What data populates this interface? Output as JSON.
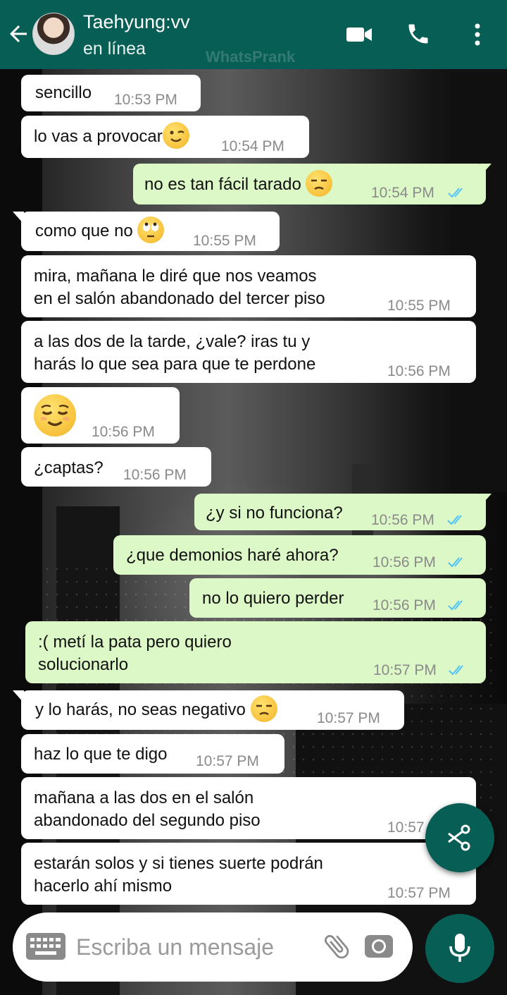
{
  "header": {
    "contact_name": "Taehyung:vv",
    "status": "en línea",
    "watermark": "WhatsPrank"
  },
  "colors": {
    "header": "#075e54",
    "incoming_bubble": "#ffffff",
    "outgoing_bubble": "#dcf8c6",
    "read_ticks": "#4fc3f7",
    "timestamp": "#8a8a8a"
  },
  "messages": [
    {
      "direction": "in",
      "text": "sencillo",
      "time": "10:53 PM"
    },
    {
      "direction": "in",
      "text": "lo vas a provocar",
      "emoji": "winking-face",
      "time": "10:54 PM"
    },
    {
      "direction": "out",
      "text": "no es tan fácil tarado",
      "emoji": "unamused-face",
      "time": "10:54 PM",
      "read": true
    },
    {
      "direction": "in",
      "text": "como que no",
      "emoji": "eye-roll-face",
      "time": "10:55 PM"
    },
    {
      "direction": "in",
      "lines": [
        "mira, mañana le diré que nos veamos",
        "en el salón abandonado del tercer piso"
      ],
      "time": "10:55 PM"
    },
    {
      "direction": "in",
      "lines": [
        "a las dos de la tarde, ¿vale? iras tu y",
        "harás lo que sea para que te perdone"
      ],
      "time": "10:56 PM"
    },
    {
      "direction": "in",
      "emoji": "relieved-face",
      "time": "10:56 PM"
    },
    {
      "direction": "in",
      "text": "¿captas?",
      "time": "10:56 PM"
    },
    {
      "direction": "out",
      "text": "¿y si no funciona?",
      "time": "10:56 PM",
      "read": true
    },
    {
      "direction": "out",
      "text": "¿que demonios haré ahora?",
      "time": "10:56 PM",
      "read": true
    },
    {
      "direction": "out",
      "text": "no lo quiero perder",
      "time": "10:56 PM",
      "read": true
    },
    {
      "direction": "out",
      "lines": [
        ":( metí la pata pero quiero",
        "solucionarlo"
      ],
      "time": "10:57 PM",
      "read": true
    },
    {
      "direction": "in",
      "text": "y lo harás, no seas negativo",
      "emoji": "unamused-face",
      "time": "10:57 PM"
    },
    {
      "direction": "in",
      "text": "haz lo que te digo",
      "time": "10:57 PM"
    },
    {
      "direction": "in",
      "lines": [
        "mañana a las dos en el salón",
        "abandonado del segundo piso"
      ],
      "time": "10:57"
    },
    {
      "direction": "in",
      "lines": [
        "estarán solos y si tienes suerte podrán",
        "hacerlo ahí mismo"
      ],
      "time": "10:57 PM"
    }
  ],
  "composer": {
    "placeholder": "Escriba un mensaje"
  },
  "icons": {
    "back": "arrow-left-icon",
    "video": "video-camera-icon",
    "call": "phone-icon",
    "menu": "more-vertical-icon",
    "fab": "scissors-icon",
    "keyboard": "keyboard-icon",
    "attach": "paperclip-icon",
    "camera": "camera-icon",
    "mic": "microphone-icon"
  }
}
